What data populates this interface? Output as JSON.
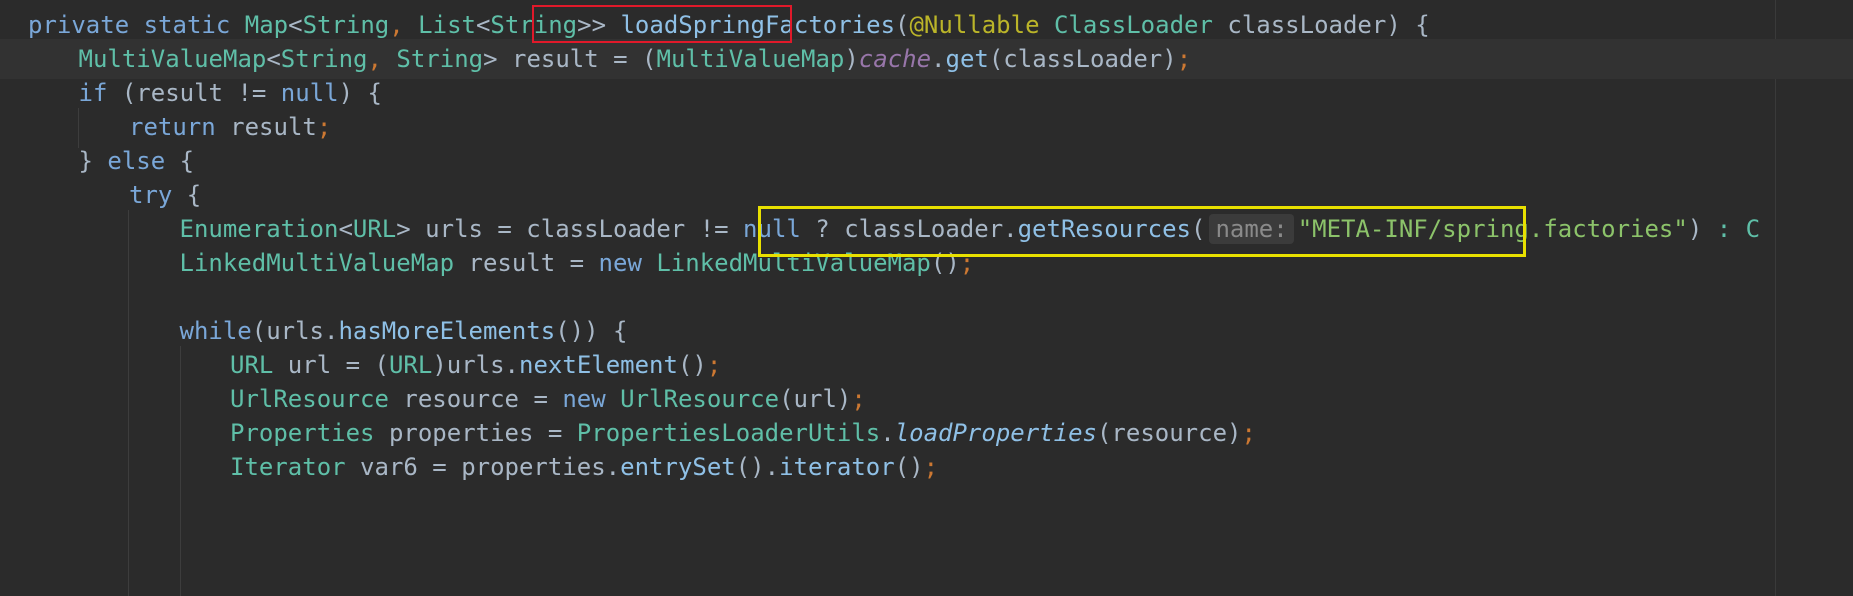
{
  "code_lines": [
    {
      "tokens": [
        {
          "t": "private static ",
          "c": "kw"
        },
        {
          "t": "Map",
          "c": "ty"
        },
        {
          "t": "<",
          "c": ""
        },
        {
          "t": "String",
          "c": "ty"
        },
        {
          "t": ", ",
          "c": "pu"
        },
        {
          "t": "List",
          "c": "ty"
        },
        {
          "t": "<",
          "c": ""
        },
        {
          "t": "String",
          "c": "ty"
        },
        {
          "t": ">> ",
          "c": ""
        },
        {
          "t": "loadSpringFactories",
          "c": "mt",
          "name": "method-name-loadSpringFactories"
        },
        {
          "t": "(",
          "c": ""
        },
        {
          "t": "@Nullable ",
          "c": "an"
        },
        {
          "t": "ClassLoader",
          "c": "ty"
        },
        {
          "t": " classLoader) {",
          "c": ""
        }
      ]
    },
    {
      "tokens": [
        {
          "t": "MultiValueMap",
          "c": "ty"
        },
        {
          "t": "<",
          "c": ""
        },
        {
          "t": "String",
          "c": "ty"
        },
        {
          "t": ", ",
          "c": "pu"
        },
        {
          "t": "String",
          "c": "ty"
        },
        {
          "t": "> result = (",
          "c": ""
        },
        {
          "t": "MultiValueMap",
          "c": "ty"
        },
        {
          "t": ")",
          "c": ""
        },
        {
          "t": "cache",
          "c": "fld"
        },
        {
          "t": ".",
          "c": ""
        },
        {
          "t": "get",
          "c": "mt"
        },
        {
          "t": "(classLoader)",
          "c": ""
        },
        {
          "t": ";",
          "c": "pu"
        }
      ]
    },
    {
      "tokens": [
        {
          "t": "if",
          "c": "kw"
        },
        {
          "t": " (result != ",
          "c": ""
        },
        {
          "t": "null",
          "c": "kw"
        },
        {
          "t": ") {",
          "c": ""
        }
      ]
    },
    {
      "tokens": [
        {
          "t": "return",
          "c": "kw"
        },
        {
          "t": " result",
          "c": ""
        },
        {
          "t": ";",
          "c": "pu"
        }
      ]
    },
    {
      "tokens": [
        {
          "t": "} ",
          "c": ""
        },
        {
          "t": "else",
          "c": "kw"
        },
        {
          "t": " {",
          "c": ""
        }
      ]
    },
    {
      "tokens": [
        {
          "t": "try",
          "c": "kw"
        },
        {
          "t": " {",
          "c": ""
        }
      ]
    },
    {
      "tokens": [
        {
          "t": "Enumeration",
          "c": "ty"
        },
        {
          "t": "<",
          "c": ""
        },
        {
          "t": "URL",
          "c": "ty"
        },
        {
          "t": "> urls = classLoader != ",
          "c": ""
        },
        {
          "t": "null",
          "c": "kw"
        },
        {
          "t": " ? ",
          "c": ""
        },
        {
          "t": "classLoader.",
          "c": ""
        },
        {
          "t": "getResources",
          "c": "mt"
        },
        {
          "t": "(",
          "c": ""
        },
        {
          "t": "name:",
          "c": "hint",
          "name": "parameter-hint-name"
        },
        {
          "t": "\"META-INF/spring.factories\"",
          "c": "st"
        },
        {
          "t": ") ",
          "c": ""
        },
        {
          "t": ": C",
          "c": "ty"
        }
      ]
    },
    {
      "tokens": [
        {
          "t": "LinkedMultiValueMap",
          "c": "ty"
        },
        {
          "t": " result = ",
          "c": ""
        },
        {
          "t": "new ",
          "c": "kw"
        },
        {
          "t": "LinkedMultiValueMap",
          "c": "ty"
        },
        {
          "t": "()",
          "c": ""
        },
        {
          "t": ";",
          "c": "pu"
        }
      ]
    },
    {
      "tokens": []
    },
    {
      "tokens": [
        {
          "t": "while",
          "c": "kw"
        },
        {
          "t": "(urls.",
          "c": ""
        },
        {
          "t": "hasMoreElements",
          "c": "mt"
        },
        {
          "t": "()) {",
          "c": ""
        }
      ]
    },
    {
      "tokens": [
        {
          "t": "URL",
          "c": "ty"
        },
        {
          "t": " url = (",
          "c": ""
        },
        {
          "t": "URL",
          "c": "ty"
        },
        {
          "t": ")urls.",
          "c": ""
        },
        {
          "t": "nextElement",
          "c": "mt"
        },
        {
          "t": "()",
          "c": ""
        },
        {
          "t": ";",
          "c": "pu"
        }
      ]
    },
    {
      "tokens": [
        {
          "t": "UrlResource",
          "c": "ty"
        },
        {
          "t": " resource = ",
          "c": ""
        },
        {
          "t": "new ",
          "c": "kw"
        },
        {
          "t": "UrlResource",
          "c": "ty"
        },
        {
          "t": "(url)",
          "c": ""
        },
        {
          "t": ";",
          "c": "pu"
        }
      ]
    },
    {
      "tokens": [
        {
          "t": "Properties",
          "c": "ty"
        },
        {
          "t": " properties = ",
          "c": ""
        },
        {
          "t": "PropertiesLoaderUtils",
          "c": "ty"
        },
        {
          "t": ".",
          "c": ""
        },
        {
          "t": "loadProperties",
          "c": "mt it"
        },
        {
          "t": "(resource)",
          "c": ""
        },
        {
          "t": ";",
          "c": "pu"
        }
      ]
    },
    {
      "tokens": [
        {
          "t": "Iterator",
          "c": "ty"
        },
        {
          "t": " var6 = properties.",
          "c": ""
        },
        {
          "t": "entrySet",
          "c": "mt"
        },
        {
          "t": "().",
          "c": ""
        },
        {
          "t": "iterator",
          "c": "mt"
        },
        {
          "t": "()",
          "c": ""
        },
        {
          "t": ";",
          "c": "pu"
        }
      ]
    }
  ],
  "colors": {
    "background": "#2b2b2b",
    "current_line": "#323232",
    "highlight_red": "#e0192a",
    "highlight_yellow": "#e8e000"
  }
}
